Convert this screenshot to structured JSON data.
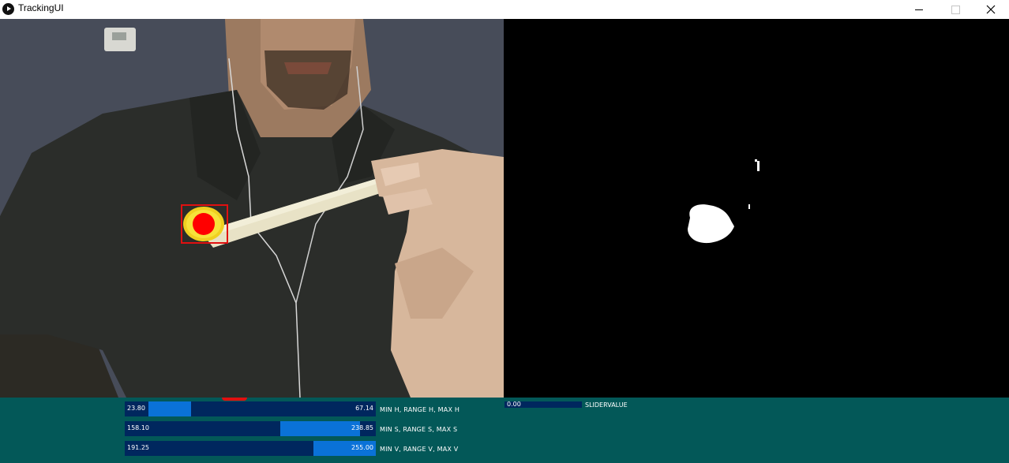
{
  "window": {
    "title": "TrackingUI"
  },
  "sliders": [
    {
      "min_label": "23.80",
      "max_label": "67.14",
      "label": "MIN H, RANGE H, MAX H",
      "low": 23.8,
      "high": 67.14,
      "max": 255
    },
    {
      "min_label": "158.10",
      "max_label": "238.85",
      "label": "MIN S, RANGE S, MAX S",
      "low": 158.1,
      "high": 238.85,
      "max": 255
    },
    {
      "min_label": "191.25",
      "max_label": "255.00",
      "label": "MIN V, RANGE V, MAX V",
      "low": 191.25,
      "high": 255.0,
      "max": 255
    }
  ],
  "single_slider": {
    "value": "0.00",
    "label": "SLIDERVALUE"
  },
  "colors": {
    "panel_bg": "#035858",
    "slider_track": "#00275e",
    "slider_fill": "#0a72d8",
    "tracking_box": "#e01010",
    "tracked_marker": "#ff0000",
    "mask_bg": "#000000",
    "mask_blob": "#ffffff"
  }
}
